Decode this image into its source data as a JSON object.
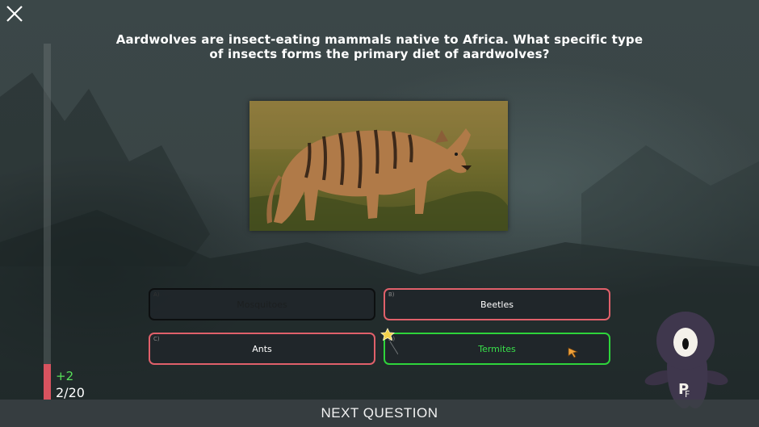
{
  "quiz": {
    "question": "Aardwolves are insect-eating mammals native to Africa. What specific type of insects forms the primary diet of aardwolves?",
    "answers": [
      {
        "letter": "A)",
        "label": "Mosquitoes"
      },
      {
        "letter": "B)",
        "label": "Beetles"
      },
      {
        "letter": "C)",
        "label": "Ants"
      },
      {
        "letter": "D)",
        "label": "Termites"
      }
    ]
  },
  "progress": {
    "score_gain": "+2",
    "count": "2/20",
    "fraction": 0.1
  },
  "footer": {
    "next_label": "NEXT QUESTION"
  },
  "icons": {
    "close": "close-icon",
    "star": "star-icon",
    "mascot": "mascot-icon",
    "cursor": "cursor-icon"
  },
  "colors": {
    "correct": "#2ed43b",
    "wrong": "#e0606a",
    "progress": "#d9535f"
  }
}
